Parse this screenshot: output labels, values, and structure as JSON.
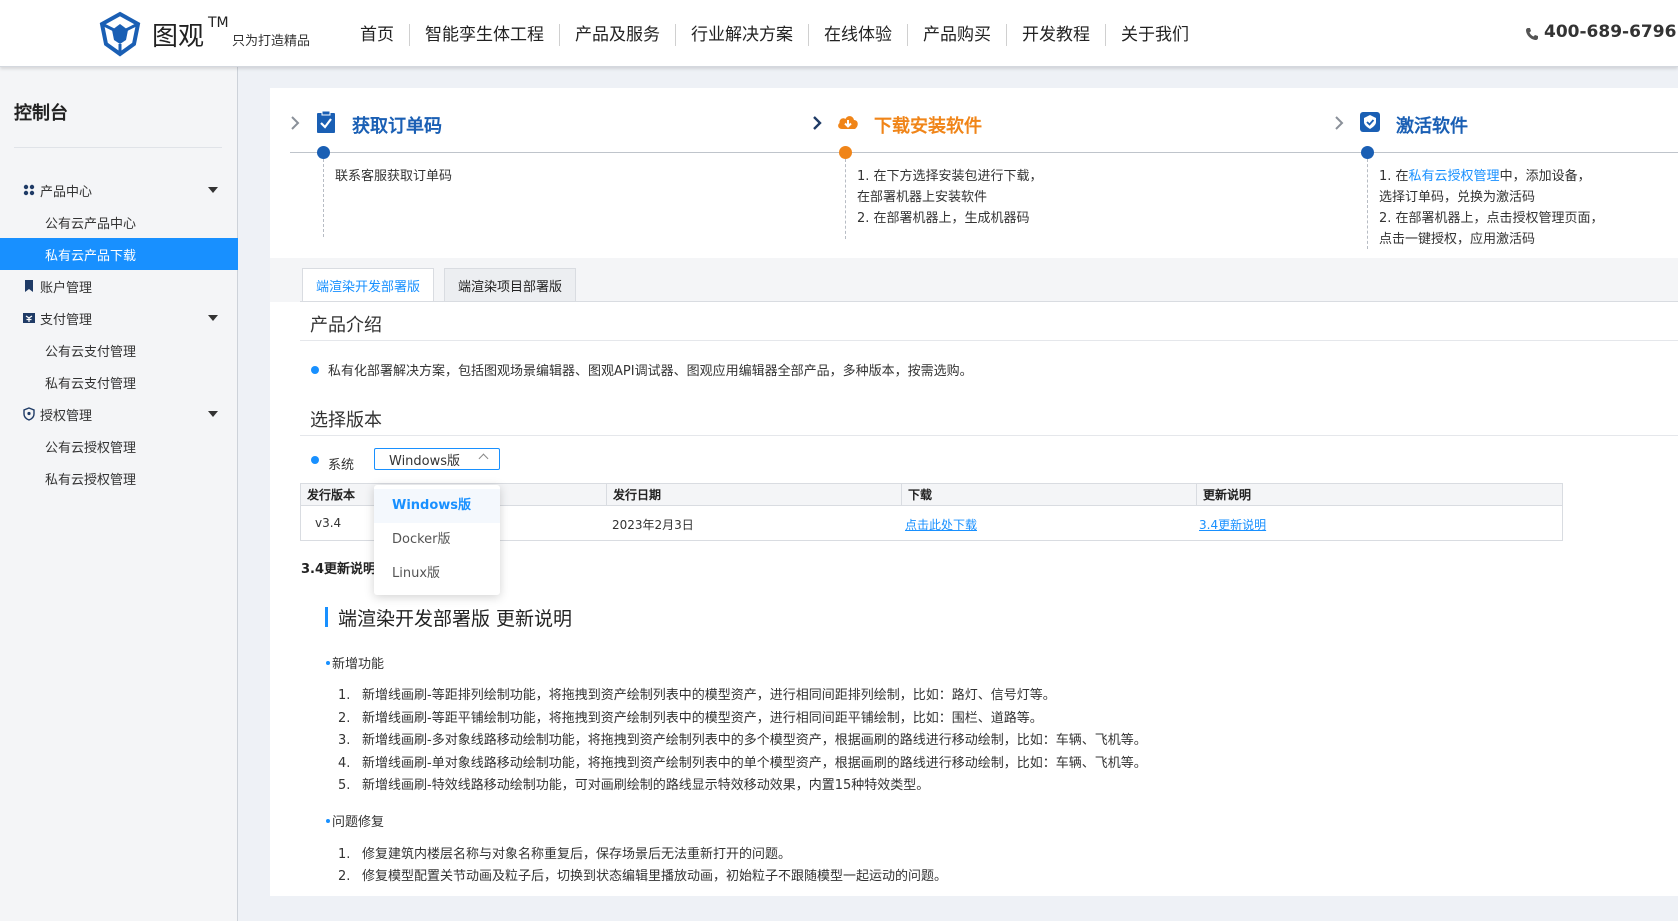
{
  "header": {
    "brand_name": "图观",
    "brand_tm": "TM",
    "slogan": "只为打造精品",
    "nav": [
      "首页",
      "智能孪生体工程",
      "产品及服务",
      "行业解决方案",
      "在线体验",
      "产品购买",
      "开发教程",
      "关于我们"
    ],
    "phone": "400-689-6796",
    "colors": {
      "accent": "#1890ff"
    }
  },
  "sidebar": {
    "title": "控制台",
    "groups": [
      {
        "label": "产品中心",
        "icon": "grid-icon",
        "children": [
          "公有云产品中心",
          "私有云产品下载"
        ]
      },
      {
        "label": "账户管理",
        "icon": "bookmark-icon",
        "children": []
      },
      {
        "label": "支付管理",
        "icon": "payment-icon",
        "children": [
          "公有云支付管理",
          "私有云支付管理"
        ]
      },
      {
        "label": "授权管理",
        "icon": "shield-icon",
        "children": [
          "公有云授权管理",
          "私有云授权管理"
        ]
      }
    ],
    "active_item": "私有云产品下载"
  },
  "steps": [
    {
      "title": "获取订单码",
      "icon": "clipboard-check-icon",
      "color": "#1a5fb4",
      "lines": [
        "联系客服获取订单码"
      ]
    },
    {
      "title": "下载安装软件",
      "icon": "cloud-download-icon",
      "color": "#f08519",
      "lines": [
        "1. 在下方选择安装包进行下载，",
        "在部署机器上安装软件",
        "2. 在部署机器上，生成机器码"
      ]
    },
    {
      "title": "激活软件",
      "icon": "badge-check-icon",
      "color": "#1a5fb4",
      "line1_prefix": "1. 在",
      "line1_link": "私有云授权管理",
      "line1_suffix": "中，添加设备，",
      "lines": [
        "选择订单码，兑换为激活码",
        "2. 在部署机器上，点击授权管理页面，",
        "点击一键授权，应用激活码"
      ]
    }
  ],
  "tabs": [
    "端渲染开发部署版",
    "端渲染项目部署版"
  ],
  "intro": {
    "title": "产品介绍",
    "text": "私有化部署解决方案，包括图观场景编辑器、图观API调试器、图观应用编辑器全部产品，多种版本，按需选购。"
  },
  "version": {
    "title": "选择版本",
    "system_label": "系统",
    "selected": "Windows版",
    "options": [
      "Windows版",
      "Docker版",
      "Linux版"
    ]
  },
  "table": {
    "headers": [
      "发行版本",
      "发行日期",
      "下载",
      "更新说明"
    ],
    "rows": [
      {
        "version": "v3.4",
        "date": "2023年2月3日",
        "download": "点击此处下载",
        "notes": "3.4更新说明"
      }
    ]
  },
  "notes": {
    "head": "3.4更新说明",
    "title": "端渲染开发部署版 更新说明",
    "groups": [
      {
        "title": "新增功能",
        "items": [
          "新增线画刷-等距排列绘制功能，将拖拽到资产绘制列表中的模型资产，进行相同间距排列绘制，比如：路灯、信号灯等。",
          "新增线画刷-等距平铺绘制功能，将拖拽到资产绘制列表中的模型资产，进行相同间距平铺绘制，比如：围栏、道路等。",
          "新增线画刷-多对象线路移动绘制功能，将拖拽到资产绘制列表中的多个模型资产，根据画刷的路线进行移动绘制，比如：车辆、飞机等。",
          "新增线画刷-单对象线路移动绘制功能，将拖拽到资产绘制列表中的单个模型资产，根据画刷的路线进行移动绘制，比如：车辆、飞机等。",
          "新增线画刷-特效线路移动绘制功能，可对画刷绘制的路线显示特效移动效果，内置15种特效类型。"
        ]
      },
      {
        "title": "问题修复",
        "items": [
          "修复建筑内楼层名称与对象名称重复后，保存场景后无法重新打开的问题。",
          "修复模型配置关节动画及粒子后，切换到状态编辑里播放动画，初始粒子不跟随模型一起运动的问题。"
        ]
      }
    ]
  }
}
